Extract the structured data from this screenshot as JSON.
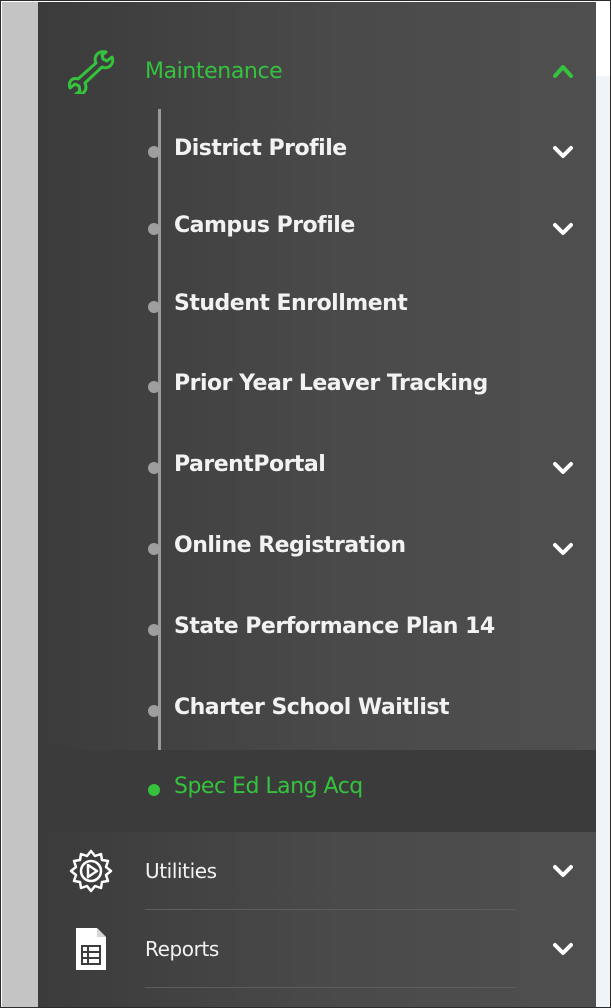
{
  "sidebar": {
    "maintenance": {
      "label": "Maintenance",
      "icon": "wrench-icon",
      "expanded": true,
      "accent_color": "#35c23c"
    },
    "items": [
      {
        "label": "District Profile",
        "has_children": true
      },
      {
        "label": "Campus Profile",
        "has_children": true
      },
      {
        "label": "Student Enrollment",
        "has_children": false
      },
      {
        "label": "Prior Year Leaver Tracking",
        "has_children": false
      },
      {
        "label": "ParentPortal",
        "has_children": true
      },
      {
        "label": "Online Registration",
        "has_children": true
      },
      {
        "label": "State Performance Plan 14",
        "has_children": false
      },
      {
        "label": "Charter School Waitlist",
        "has_children": false
      },
      {
        "label": "Spec Ed Lang Acq",
        "has_children": false,
        "active": true
      }
    ],
    "utilities": {
      "label": "Utilities",
      "icon": "gear-play-icon"
    },
    "reports": {
      "label": "Reports",
      "icon": "document-icon"
    }
  }
}
